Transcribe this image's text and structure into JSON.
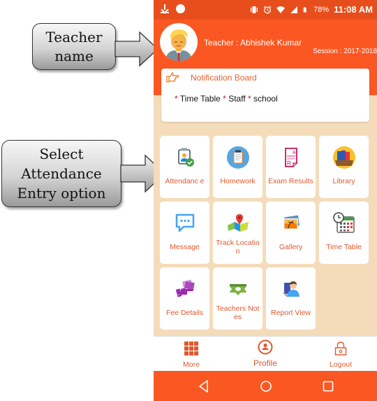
{
  "annotations": {
    "teacher_callout": {
      "line1": "Teacher",
      "line2": "name"
    },
    "attendance_callout": {
      "line1": "Select",
      "line2": "Attendance",
      "line3": "Entry option"
    }
  },
  "status_bar": {
    "battery": "78%",
    "time": "11:08 AM",
    "icons": [
      "download-icon",
      "circle-notification-icon",
      "vibrate-icon",
      "alarm-icon",
      "wifi-icon",
      "signal-icon",
      "battery-icon"
    ]
  },
  "header": {
    "teacher_label": "Teacher : Abhishek Kumar",
    "session_label": "Session : 2017-2018"
  },
  "notification_board": {
    "title": "Notification Board",
    "items": [
      "Time Table",
      "Staff",
      "school"
    ],
    "bullet": "*"
  },
  "menu": [
    {
      "label": "Attendanc e",
      "icon": "attendance-icon"
    },
    {
      "label": "Homework",
      "icon": "homework-clipboard-icon"
    },
    {
      "label": "Exam Results",
      "icon": "exam-results-icon"
    },
    {
      "label": "Library",
      "icon": "library-books-icon"
    },
    {
      "label": "Message",
      "icon": "message-icon"
    },
    {
      "label": "Track Location",
      "icon": "map-pin-icon"
    },
    {
      "label": "Gallery",
      "icon": "gallery-icon"
    },
    {
      "label": "Time Table",
      "icon": "calendar-clock-icon"
    },
    {
      "label": "Fee Details",
      "icon": "fee-payment-icon"
    },
    {
      "label": "Teachers Notes",
      "icon": "notes-icon"
    },
    {
      "label": "Report View",
      "icon": "report-view-icon"
    }
  ],
  "bottom_nav": {
    "more": "More",
    "profile": "Profile",
    "logout": "Logout"
  },
  "colors": {
    "primary": "#fa5722",
    "status_bar": "#e84e1b",
    "background": "#f4dcbb",
    "label": "#e0582b"
  }
}
